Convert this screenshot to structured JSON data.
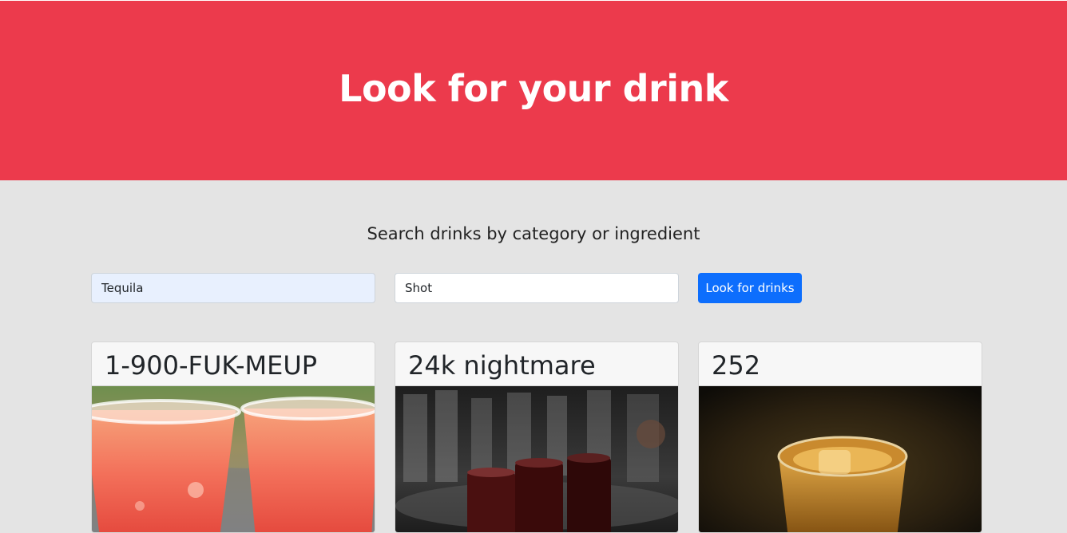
{
  "hero": {
    "title": "Look for your drink",
    "background_color": "#ec3a4c"
  },
  "search": {
    "subtitle": "Search drinks by category or ingredient",
    "ingredient_value": "Tequila",
    "category_value": "Shot",
    "button_label": "Look for drinks",
    "button_color": "#0d6efd"
  },
  "drinks": [
    {
      "name": "1-900-FUK-MEUP",
      "image": "two-red-cocktail-cups"
    },
    {
      "name": "24k nightmare",
      "image": "dark-shot-glasses-on-bar"
    },
    {
      "name": "252",
      "image": "amber-shot-glass"
    }
  ]
}
